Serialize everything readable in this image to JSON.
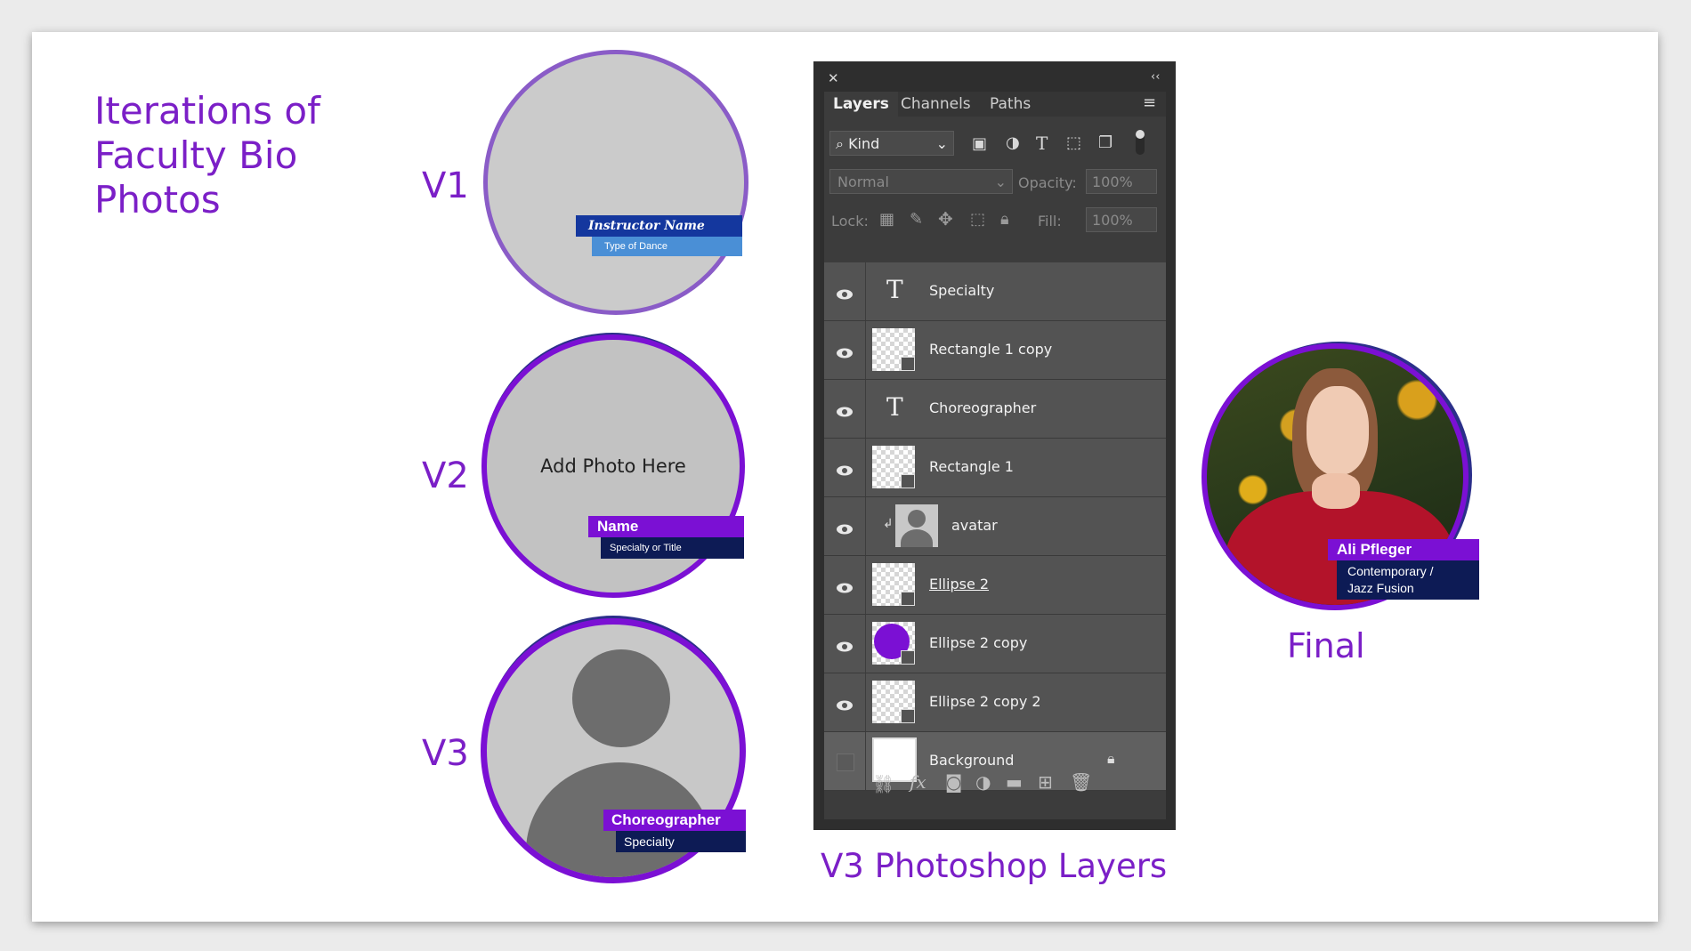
{
  "title_lines": [
    "Iterations of",
    "Faculty Bio",
    "Photos"
  ],
  "versions": {
    "v1": {
      "label": "V1",
      "name_tag": "Instructor Name",
      "sub_tag": "Type of Dance"
    },
    "v2": {
      "label": "V2",
      "center_text": "Add Photo Here",
      "name_tag": "Name",
      "sub_tag": "Specialty or Title"
    },
    "v3": {
      "label": "V3",
      "name_tag": "Choreographer",
      "sub_tag": "Specialty"
    }
  },
  "photoshop": {
    "caption": "V3 Photoshop Layers",
    "tabs": [
      "Layers",
      "Channels",
      "Paths"
    ],
    "filter": "Kind",
    "blend_mode": "Normal",
    "opacity_label": "Opacity:",
    "opacity_value": "100%",
    "lock_label": "Lock:",
    "fill_label": "Fill:",
    "fill_value": "100%",
    "layers": [
      {
        "name": "Specialty",
        "kind": "text"
      },
      {
        "name": "Rectangle 1 copy",
        "kind": "shape"
      },
      {
        "name": "Choreographer",
        "kind": "text"
      },
      {
        "name": "Rectangle 1",
        "kind": "shape"
      },
      {
        "name": "avatar",
        "kind": "avatar"
      },
      {
        "name": "Ellipse 2",
        "kind": "shape"
      },
      {
        "name": "Ellipse 2 copy",
        "kind": "shape-purple"
      },
      {
        "name": "Ellipse 2 copy 2",
        "kind": "shape"
      },
      {
        "name": "Background",
        "kind": "background"
      }
    ]
  },
  "final": {
    "label": "Final",
    "name_tag": "Ali Pfleger",
    "sub_tag_line1": "Contemporary /",
    "sub_tag_line2": "Jazz Fusion"
  },
  "colors": {
    "purple": "#7b1fc7",
    "navy": "#0d1b55",
    "v1_blue": "#1a3b9c",
    "v1_light_blue": "#4a90d9"
  }
}
